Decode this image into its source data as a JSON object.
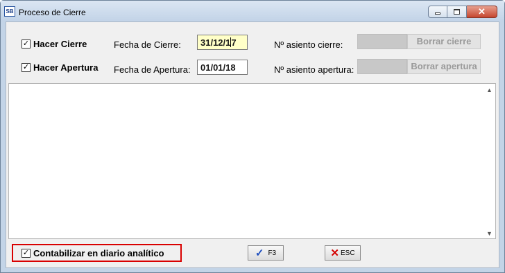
{
  "window": {
    "title": "Proceso de Cierre",
    "app_icon_text": "SB",
    "minimize_icon": "minimize-icon",
    "maximize_icon": "maximize-icon",
    "close_icon": "close-icon",
    "close_glyph": "✕"
  },
  "closing": {
    "checkbox_label": "Hacer Cierre",
    "checked": true,
    "date_label": "Fecha de Cierre:",
    "date_value_before_caret": "31/12/1",
    "date_value_after_caret": "7",
    "entry_label": "Nº asiento cierre:",
    "delete_button": "Borrar cierre"
  },
  "opening": {
    "checkbox_label": "Hacer Apertura",
    "checked": true,
    "date_label": "Fecha de Apertura:",
    "date_value": "01/01/18",
    "entry_label": "Nº asiento apertura:",
    "delete_button": "Borrar apertura"
  },
  "bottom": {
    "analytic_label": "Contabilizar en diario analítico",
    "analytic_checked": true,
    "ok_key": "F3",
    "cancel_key": "ESC",
    "ok_icon": "checkmark-icon",
    "cancel_icon": "x-icon"
  },
  "glyphs": {
    "check": "✓",
    "scroll_up": "▲",
    "scroll_down": "▼",
    "x": "✕"
  },
  "colors": {
    "highlight_border": "#d90000",
    "date_field_active": "#ffffc8",
    "check_icon": "#1f4fbf",
    "x_icon": "#d40000"
  }
}
